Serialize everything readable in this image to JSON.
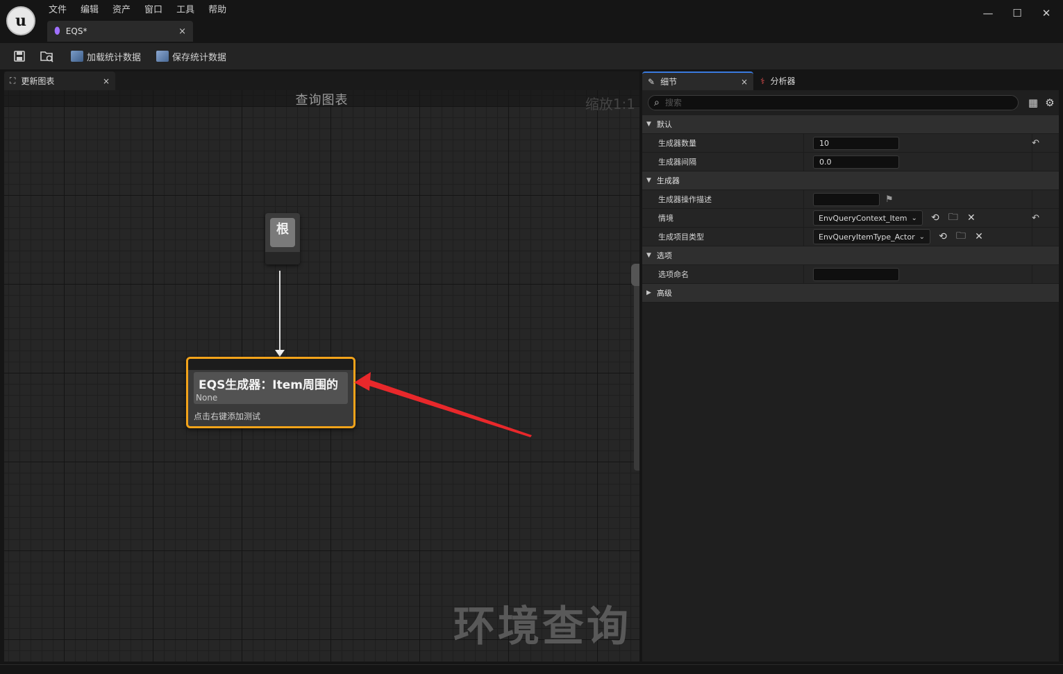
{
  "menu": [
    "文件",
    "编辑",
    "资产",
    "窗口",
    "工具",
    "帮助"
  ],
  "document_tab": {
    "label": "EQS*",
    "close": "×"
  },
  "window_controls": {
    "minimize": "—",
    "maximize": "☐",
    "close": "✕"
  },
  "toolbar": {
    "load_stats": "加载统计数据",
    "save_stats": "保存统计数据"
  },
  "graph_panel": {
    "tab_label": "更新图表",
    "tab_close": "×",
    "title": "查询图表",
    "zoom": "缩放1:1",
    "watermark": "环境查询",
    "root_node": "根",
    "generator_node": {
      "title": "EQS生成器：Item周围的",
      "subtitle": "None",
      "hint": "点击右键添加测试"
    }
  },
  "details_panel": {
    "tabs": [
      {
        "label": "细节",
        "close": "×"
      },
      {
        "label": "分析器"
      }
    ],
    "search": {
      "placeholder": "搜索"
    },
    "categories": [
      {
        "label": "默认"
      },
      {
        "label": "生成器"
      },
      {
        "label": "选项"
      },
      {
        "label": "高级"
      }
    ],
    "properties": {
      "generator_count": {
        "label": "生成器数量",
        "value": "10"
      },
      "generator_interval": {
        "label": "生成器间隔",
        "value": "0.0"
      },
      "generator_op_desc": {
        "label": "生成器操作描述",
        "value": ""
      },
      "context": {
        "label": "情境",
        "value": "EnvQueryContext_Item"
      },
      "item_type": {
        "label": "生成项目类型",
        "value": "EnvQueryItemType_Actor"
      },
      "option_name": {
        "label": "选项命名",
        "value": ""
      }
    }
  },
  "colors": {
    "selected_node_border": "#f2a31a",
    "annotation_arrow": "#e8282b",
    "active_tab_accent": "#3a7be0"
  }
}
